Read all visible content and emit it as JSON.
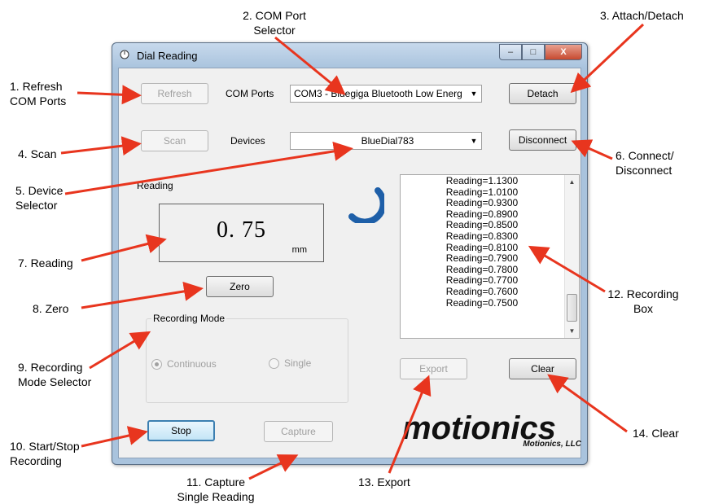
{
  "annotations": {
    "a1": "1. Refresh\nCOM Ports",
    "a2": "2. COM Port\nSelector",
    "a3": "3. Attach/Detach",
    "a4": "4. Scan",
    "a5": "5. Device\nSelector",
    "a6": "6. Connect/\nDisconnect",
    "a7": "7. Reading",
    "a8": "8. Zero",
    "a9": "9. Recording\nMode Selector",
    "a10": "10. Start/Stop\nRecording",
    "a11": "11. Capture\nSingle Reading",
    "a12": "12. Recording\nBox",
    "a13": "13. Export",
    "a14": "14. Clear"
  },
  "window": {
    "title": "Dial Reading",
    "controls": {
      "min": "–",
      "max": "□",
      "close": "X"
    }
  },
  "toolbar": {
    "refresh_label": "Refresh",
    "com_ports_label": "COM Ports",
    "com_port_value": "COM3 - Bluegiga Bluetooth Low Energ",
    "detach_label": "Detach",
    "scan_label": "Scan",
    "devices_label": "Devices",
    "device_value": "BlueDial783",
    "disconnect_label": "Disconnect"
  },
  "reading": {
    "label": "Reading",
    "value": "0. 75",
    "unit": "mm",
    "zero_label": "Zero"
  },
  "recording_mode": {
    "title": "Recording Mode",
    "continuous_label": "Continuous",
    "single_label": "Single",
    "selected": "Continuous"
  },
  "recording_box": {
    "items": [
      "Reading=1.1300",
      "Reading=1.0100",
      "Reading=0.9300",
      "Reading=0.8900",
      "Reading=0.8500",
      "Reading=0.8300",
      "Reading=0.8100",
      "Reading=0.7900",
      "Reading=0.7800",
      "Reading=0.7700",
      "Reading=0.7600",
      "Reading=0.7500"
    ]
  },
  "actions": {
    "export_label": "Export",
    "clear_label": "Clear",
    "stop_label": "Stop",
    "capture_label": "Capture"
  },
  "logo": {
    "word": "motionics",
    "company": "Motionics, LLC"
  },
  "colors": {
    "arrow": "#e8351e",
    "spinner": "#1e5fa8",
    "window_frame": "#a9c3dd",
    "close_button": "#c74a30"
  }
}
